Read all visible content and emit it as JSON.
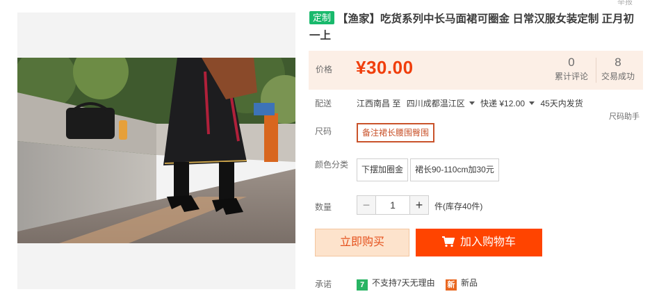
{
  "title": {
    "tag": "定制",
    "text": "【渔家】吃货系列中长马面裙可圈金 日常汉服女装定制 正月初一上"
  },
  "top_cut_text": "举报",
  "price": {
    "label": "价格",
    "value": "¥30.00"
  },
  "stats": [
    {
      "num": "0",
      "label": "累计评论"
    },
    {
      "num": "8",
      "label": "交易成功"
    }
  ],
  "shipping": {
    "label": "配送",
    "route_from": "江西南昌 至",
    "route_to": "四川成都温江区",
    "fee": "快递 ¥12.00",
    "dispatch": "45天内发货"
  },
  "size": {
    "label": "尺码",
    "helper": "尺码助手",
    "options": [
      {
        "label": "备注裙长腰围臀围",
        "selected": true
      }
    ]
  },
  "color": {
    "label": "颜色分类",
    "options": [
      {
        "label": "下摆加圈金"
      },
      {
        "label": "裙长90-110cm加30元"
      }
    ]
  },
  "quantity": {
    "label": "数量",
    "minus": "−",
    "value": "1",
    "plus": "+",
    "stock": "件(库存40件)"
  },
  "actions": {
    "buy_now": "立即购买",
    "add_cart": "加入购物车"
  },
  "promise": {
    "label": "承诺",
    "items": [
      {
        "badge": "7",
        "text": "不支持7天无理由"
      },
      {
        "badge": "新",
        "text": "新品"
      }
    ]
  },
  "colors": {
    "price_red": "#f03e0c",
    "cart_orange": "#ff4400",
    "buy_bg": "#fde3cc",
    "price_bg": "#fcefe6",
    "tag_green": "#19b96c"
  },
  "icons": [
    "cart-icon"
  ]
}
